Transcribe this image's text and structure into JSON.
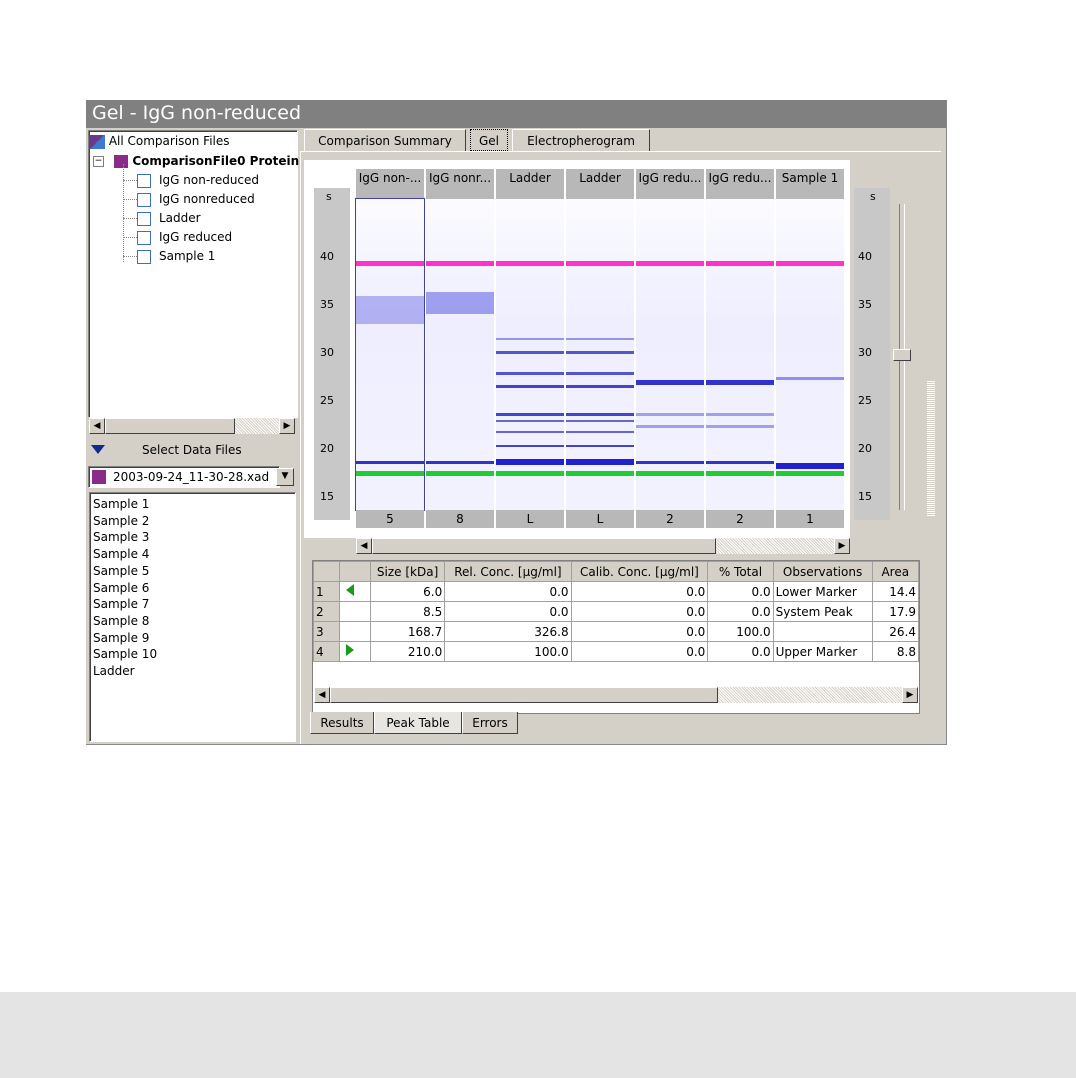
{
  "window": {
    "title": "Gel - IgG non-reduced"
  },
  "tree": {
    "root_label": "All Comparison Files",
    "file_label": "ComparisonFile0 Protein",
    "samples": [
      "IgG non-reduced",
      "IgG nonreduced",
      "Ladder",
      "IgG reduced",
      "Sample 1"
    ]
  },
  "select_data_files": {
    "label": "Select Data Files",
    "selected_file": "2003-09-24_11-30-28.xad",
    "list": [
      "Sample 1",
      "Sample 2",
      "Sample 3",
      "Sample 4",
      "Sample 5",
      "Sample 6",
      "Sample 7",
      "Sample 8",
      "Sample 9",
      "Sample 10",
      "Ladder"
    ]
  },
  "tabs": [
    "Comparison Summary",
    "Gel",
    "Electropherogram"
  ],
  "gel": {
    "lanes": [
      {
        "header": "IgG non-...",
        "footer": "5"
      },
      {
        "header": "IgG nonr...",
        "footer": "8"
      },
      {
        "header": "Ladder",
        "footer": "L"
      },
      {
        "header": "Ladder",
        "footer": "L"
      },
      {
        "header": "IgG redu...",
        "footer": "2"
      },
      {
        "header": "IgG redu...",
        "footer": "2"
      },
      {
        "header": "Sample 1",
        "footer": "1"
      }
    ],
    "scale_unit": "s",
    "scale_ticks": [
      "40",
      "35",
      "30",
      "25",
      "20",
      "15"
    ],
    "colors": {
      "upper_marker": "#ff33cc",
      "lower_marker": "#22cc33",
      "band": "#3333cc"
    }
  },
  "peak_table": {
    "columns": [
      "",
      "",
      "Size [kDa]",
      "Rel. Conc. [µg/ml]",
      "Calib. Conc. [µg/ml]",
      "% Total",
      "Observations",
      "Area"
    ],
    "rows": [
      {
        "n": "1",
        "size": "6.0",
        "rel": "0.0",
        "calib": "0.0",
        "total": "0.0",
        "obs": "Lower Marker",
        "area": "14.4"
      },
      {
        "n": "2",
        "size": "8.5",
        "rel": "0.0",
        "calib": "0.0",
        "total": "0.0",
        "obs": "System Peak",
        "area": "17.9"
      },
      {
        "n": "3",
        "size": "168.7",
        "rel": "326.8",
        "calib": "0.0",
        "total": "100.0",
        "obs": "",
        "area": "26.4"
      },
      {
        "n": "4",
        "size": "210.0",
        "rel": "100.0",
        "calib": "0.0",
        "total": "0.0",
        "obs": "Upper Marker",
        "area": "8.8"
      }
    ]
  },
  "bottom_tabs": [
    "Results",
    "Peak Table",
    "Errors"
  ]
}
